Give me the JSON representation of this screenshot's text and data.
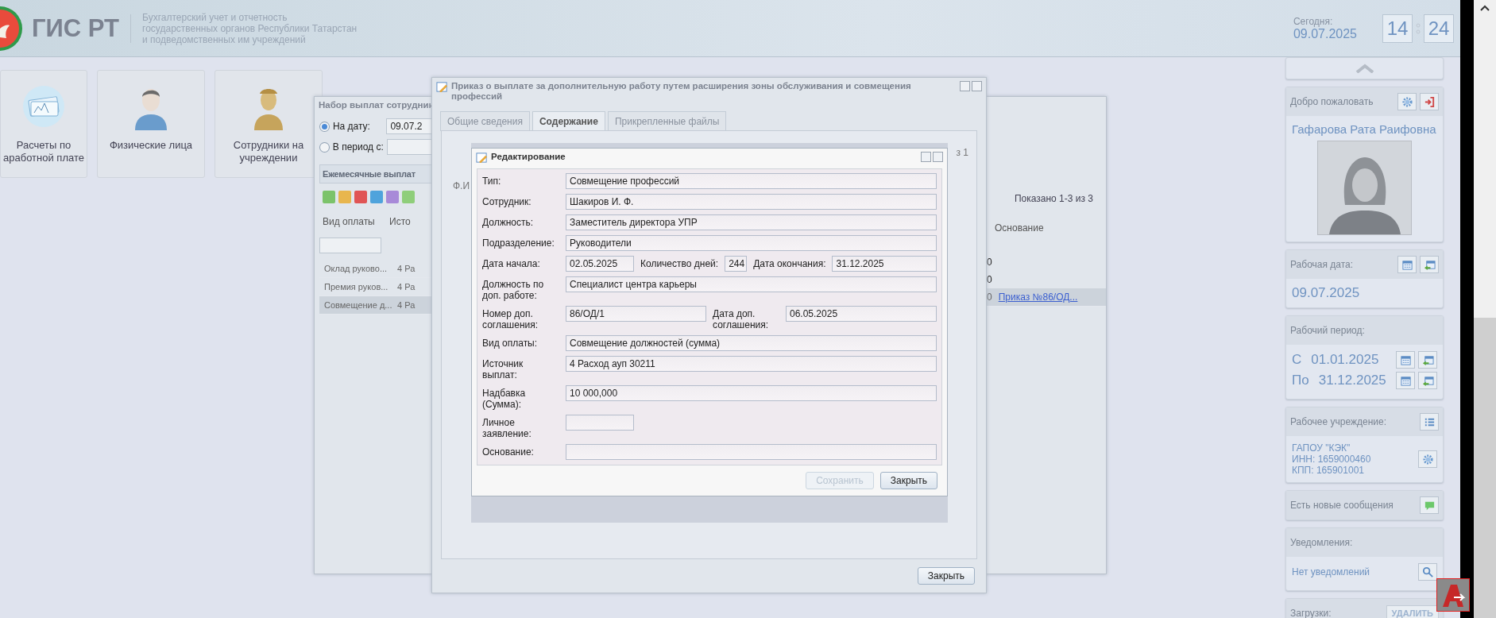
{
  "header": {
    "title": "ГИС РТ",
    "subtitle": [
      "Бухгалтерский учет и отчетность",
      "государственных органов Республики Татарстан",
      "и подведомственных им учреждений"
    ],
    "today_label": "Сегодня:",
    "today": "09.07.2025",
    "clock": [
      "14",
      "24"
    ]
  },
  "tiles": [
    {
      "kind": "money",
      "lines": [
        "Расчеты по",
        "аработной плате"
      ]
    },
    {
      "kind": "person",
      "lines": [
        "Физические лица"
      ]
    },
    {
      "kind": "staff",
      "lines": [
        "Сотрудники на",
        "учреждении"
      ]
    }
  ],
  "payments_window": {
    "title": "Набор выплат сотрудник",
    "date_options": [
      {
        "label": "На дату:",
        "selected": true,
        "value": "09.07.2"
      },
      {
        "label": "В период с:",
        "selected": false
      }
    ],
    "tab": "Ежемесячные выплат",
    "columns": [
      "Вид оплаты",
      "Исто"
    ],
    "pager": "Показано 1-3 из 3",
    "right_column": "Основание",
    "rows": [
      {
        "cells": [
          "Оклад руково...",
          "4 Ра"
        ],
        "tail": "0",
        "selected": false
      },
      {
        "cells": [
          "Премия руков...",
          "4 Ра"
        ],
        "tail": "0",
        "selected": false
      },
      {
        "cells": [
          "Совмещение д...",
          "4 Ра"
        ],
        "tail": "0",
        "link": "Приказ №86/ОД...",
        "selected": true
      }
    ]
  },
  "order_window": {
    "title": "Приказ о выплате за дополнительную работу путем расширения зоны обслуживания и совмещения профессий",
    "tabs": [
      {
        "label": "Общие сведения",
        "selected": false
      },
      {
        "label": "Содержание",
        "selected": true
      },
      {
        "label": "Прикрепленные файлы",
        "selected": false
      }
    ],
    "grid_fragment": "Ф.И",
    "pager_fragment": "з 1",
    "close_button": "Закрыть"
  },
  "edit_dialog": {
    "title": "Редактирование",
    "rows": [
      {
        "kind": "wide",
        "fields": [
          {
            "label": "Тип:",
            "value": "Совмещение профессий"
          }
        ]
      },
      {
        "kind": "wide",
        "fields": [
          {
            "label": "Сотрудник:",
            "value": "Шакиров И. Ф."
          }
        ]
      },
      {
        "kind": "wide",
        "fields": [
          {
            "label": "Должность:",
            "value": "Заместитель директора УПР"
          }
        ]
      },
      {
        "kind": "wide",
        "fields": [
          {
            "label": "Подразделение:",
            "value": "Руководители"
          }
        ]
      },
      {
        "kind": "triple",
        "fields": [
          {
            "label": "Дата начала:",
            "value": "02.05.2025"
          },
          {
            "label": "Количество дней:",
            "value": "244"
          },
          {
            "label": "Дата окончания:",
            "value": "31.12.2025"
          }
        ]
      },
      {
        "kind": "wide",
        "fields": [
          {
            "label": "Должность по доп. работе:",
            "value": "Специалист центра карьеры"
          }
        ]
      },
      {
        "kind": "pair",
        "fields": [
          {
            "label": "Номер доп. соглашения:",
            "value": "86/ОД/1"
          },
          {
            "label": "Дата доп. соглашения:",
            "value": "06.05.2025"
          }
        ]
      },
      {
        "kind": "wide",
        "fields": [
          {
            "label": "Вид оплаты:",
            "value": "Совмещение должностей (сумма)"
          }
        ]
      },
      {
        "kind": "wide",
        "fields": [
          {
            "label": "Источник выплат:",
            "value": "4 Расход ауп 30211"
          }
        ]
      },
      {
        "kind": "wide",
        "fields": [
          {
            "label": "Надбавка (Сумма):",
            "value": "10 000,000"
          }
        ]
      },
      {
        "kind": "short",
        "fields": [
          {
            "label": "Личное заявление:"
          }
        ]
      },
      {
        "kind": "wide",
        "fields": [
          {
            "label": "Основание:"
          }
        ]
      }
    ],
    "buttons": [
      {
        "label": "Сохранить",
        "disabled": true
      },
      {
        "label": "Закрыть",
        "disabled": false
      }
    ]
  },
  "sidebar": {
    "welcome": {
      "title": "Добро пожаловать",
      "name": "Гафарова Рата Раифовна"
    },
    "work_date": {
      "title": "Рабочая дата:",
      "value": "09.07.2025"
    },
    "work_period": {
      "title": "Рабочий период:",
      "rows": [
        {
          "prefix": "С",
          "date": "01.01.2025"
        },
        {
          "prefix": "По",
          "date": "31.12.2025"
        }
      ]
    },
    "org": {
      "title": "Рабочее учреждение:",
      "lines": [
        "ГАПОУ \"КЭК\"",
        "ИНН: 1659000460",
        "КПП: 165901001"
      ]
    },
    "messages": {
      "text": "Есть новые сообщения"
    },
    "notifications": {
      "title": "Уведомления:",
      "text": "Нет уведомлений"
    },
    "downloads": {
      "title": "Загрузки:",
      "button": "УДАЛИТЬ"
    }
  }
}
